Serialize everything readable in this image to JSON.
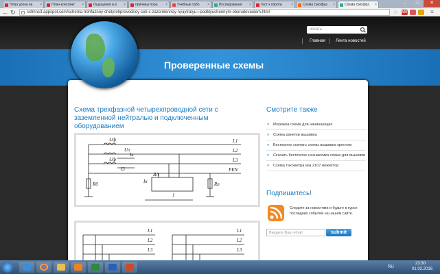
{
  "browser": {
    "tabs": [
      {
        "label": "План урока на",
        "fav": "#d23"
      },
      {
        "label": "План-конспект",
        "fav": "#d23"
      },
      {
        "label": "Ощущения и в",
        "fav": "#d23"
      },
      {
        "label": "причины пора",
        "fav": "#d23"
      },
      {
        "label": "Учебные табо",
        "fav": "#e44"
      },
      {
        "label": "Исследования",
        "fav": "#3a8"
      },
      {
        "label": "тест к опроти",
        "fav": "#d23"
      },
      {
        "label": "Схема трехфаз",
        "fav": "#f60"
      },
      {
        "label": "Схема трехфаз",
        "fav": "#3a8"
      }
    ],
    "url": "sxtmns3.appspot.com/schema-trehfaznoy-chetyrehprovodnoy-seti-s-zazemlennoy-nyaytralyu-i-podklyuchennym-oborudovaniem.html"
  },
  "header": {
    "search_placeholder": "искать",
    "nav": [
      "Главная",
      "Лента новостей"
    ],
    "site_title": "Проверенные схемы"
  },
  "article": {
    "title": "Схема трехфазной четырехпроводной сети с заземленной нейтралью и подключенным оборудованием"
  },
  "diagram": {
    "labels": {
      "uf": "Uф",
      "ul": "Uл",
      "ul2": "Uф",
      "ik": "Iк",
      "i3": "I3",
      "l1": "L1",
      "l2": "L2",
      "l3": "L3",
      "pen": "PEN",
      "r0": "R0",
      "rn": "Rn",
      "ik2": "Iк",
      "one": "1",
      "va": "BA"
    },
    "labels2": {
      "l1": "L1",
      "l2": "L2",
      "l3": "L3",
      "l1b": "L1",
      "l2b": "L2",
      "l3b": "L3"
    }
  },
  "sidebar": {
    "see_also_title": "Смотрите также",
    "links": [
      "Мережка схема для начинающих",
      "Схема ранетки вышивка",
      "Бесплатно скачать схемы вышивка крестом",
      "Скачать бесплатно незнакомка схема для вышивки",
      "Схема тахометра ваз 2107 инжектор"
    ],
    "subscribe_title": "Подпишитесь!",
    "subscribe_text": "Следите за новостями и будьте в курсе последних событий на нашем сайте.",
    "email_placeholder": "Введите Ваш email",
    "submit_label": "submit"
  },
  "taskbar": {
    "lang": "RU",
    "time": "23:30",
    "date": "01.02.2016"
  }
}
